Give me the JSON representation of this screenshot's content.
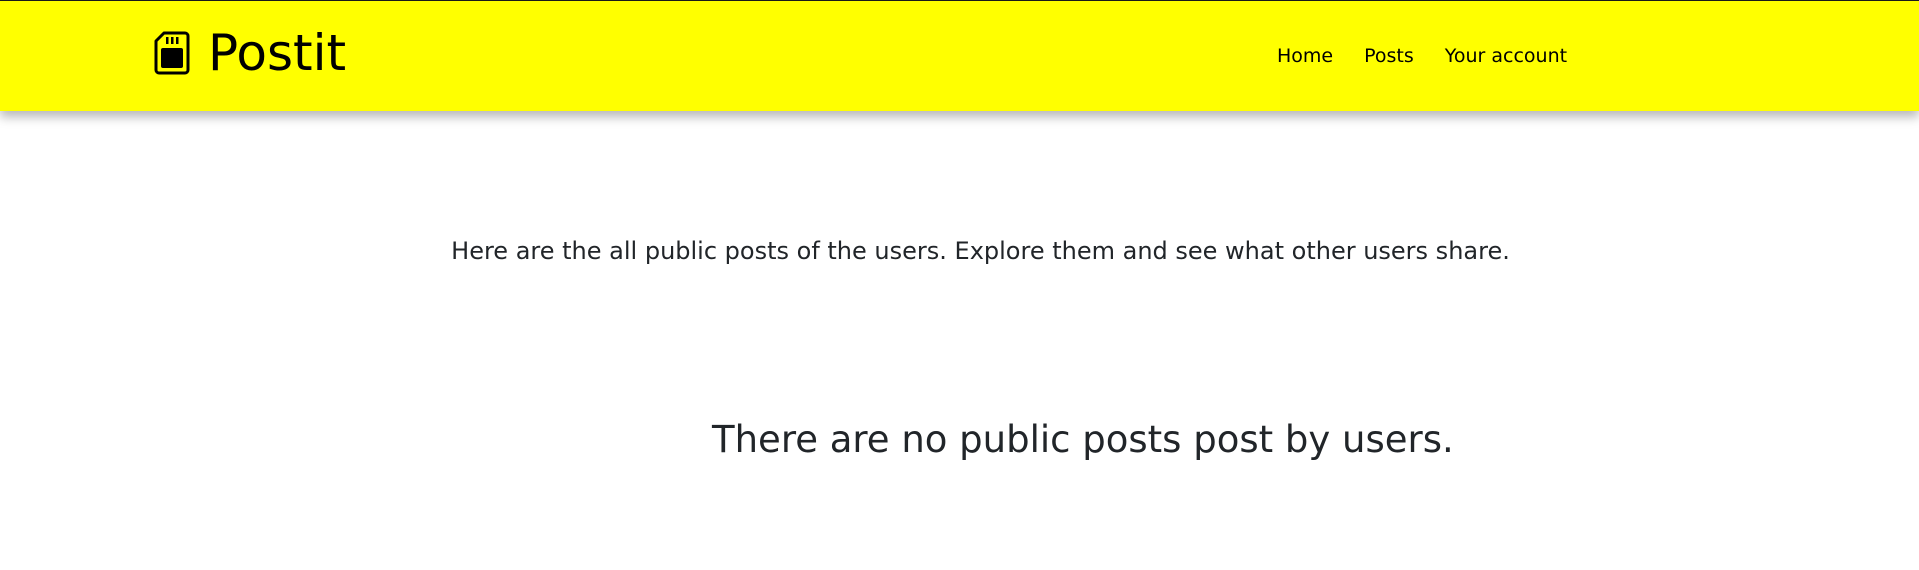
{
  "navbar": {
    "brand": "Postit",
    "brand_icon": "sd-card-icon",
    "background_color": "#ffff00",
    "links": [
      {
        "label": "Home"
      },
      {
        "label": "Posts"
      },
      {
        "label": "Your account"
      }
    ]
  },
  "main": {
    "intro_text": "Here are the all public posts of the users. Explore them and see what other users share.",
    "empty_message": "There are no public posts post by users."
  }
}
